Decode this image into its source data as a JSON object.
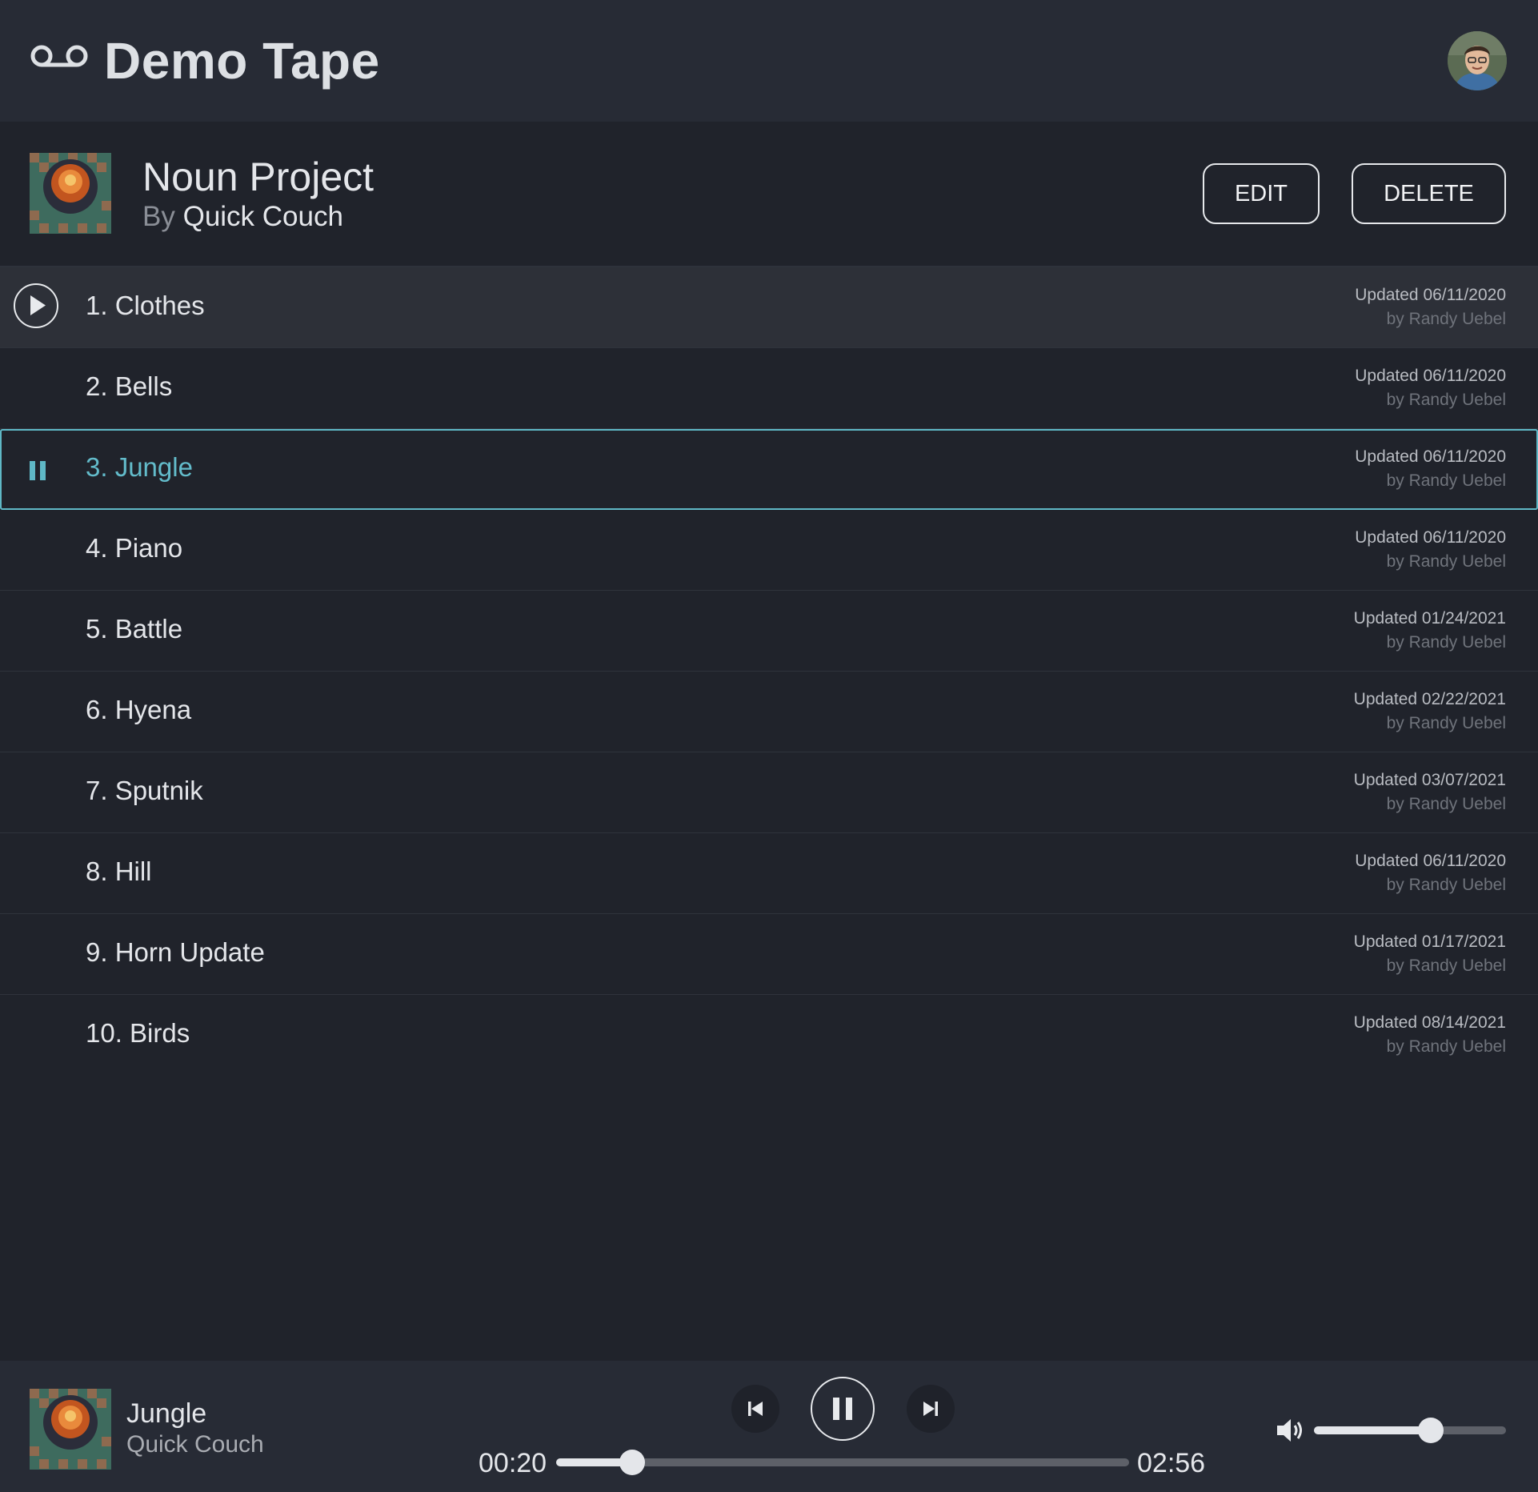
{
  "app": {
    "title": "Demo Tape",
    "logo_icon": "voicemail-icon",
    "avatar_icon": "user-avatar"
  },
  "project": {
    "title": "Noun Project",
    "by_word": "By",
    "artist": "Quick Couch",
    "edit_label": "EDIT",
    "delete_label": "DELETE"
  },
  "tracks": [
    {
      "label": "1. Clothes",
      "updated": "Updated 06/11/2020",
      "author": "by Randy Uebel",
      "state": "hover"
    },
    {
      "label": "2. Bells",
      "updated": "Updated 06/11/2020",
      "author": "by Randy Uebel",
      "state": "normal"
    },
    {
      "label": "3. Jungle",
      "updated": "Updated 06/11/2020",
      "author": "by Randy Uebel",
      "state": "playing"
    },
    {
      "label": "4. Piano",
      "updated": "Updated 06/11/2020",
      "author": "by Randy Uebel",
      "state": "normal"
    },
    {
      "label": "5. Battle",
      "updated": "Updated 01/24/2021",
      "author": "by Randy Uebel",
      "state": "normal"
    },
    {
      "label": "6. Hyena",
      "updated": "Updated 02/22/2021",
      "author": "by Randy Uebel",
      "state": "normal"
    },
    {
      "label": "7. Sputnik",
      "updated": "Updated 03/07/2021",
      "author": "by Randy Uebel",
      "state": "normal"
    },
    {
      "label": "8. Hill",
      "updated": "Updated 06/11/2020",
      "author": "by Randy Uebel",
      "state": "normal"
    },
    {
      "label": "9. Horn Update",
      "updated": "Updated 01/17/2021",
      "author": "by Randy Uebel",
      "state": "normal"
    },
    {
      "label": "10. Birds",
      "updated": "Updated 08/14/2021",
      "author": "by Randy Uebel",
      "state": "normal"
    }
  ],
  "player": {
    "title": "Jungle",
    "artist": "Quick Couch",
    "current_time": "00:20",
    "total_time": "02:56",
    "progress_fraction": 0.132,
    "volume_fraction": 0.61,
    "icons": [
      "skip-previous-icon",
      "pause-icon",
      "skip-next-icon",
      "volume-icon"
    ]
  },
  "colors": {
    "background": "#20232b",
    "header": "#272b35",
    "accent": "#5fb8c6",
    "text": "#e4e6ea",
    "muted": "#6f737b"
  }
}
